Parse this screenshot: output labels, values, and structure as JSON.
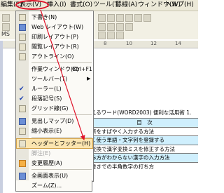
{
  "menubar": {
    "edit": "編集(E)",
    "view": "表示(V)",
    "insert": "挿入(I)",
    "format": "書式(O)",
    "tools": "ツール(T)",
    "table": "罫線(A)",
    "window": "ウィンドウ(W)",
    "help": "ヘルプ(H)"
  },
  "toolbar": {
    "font_label": "MS"
  },
  "ruler": {
    "digits": [
      "8",
      "10",
      "12",
      "14"
    ]
  },
  "view_menu": {
    "items": [
      {
        "label": "下書き(N)",
        "icon": "draft-icon"
      },
      {
        "label": "Web レイアウト(W)",
        "icon": "web-layout-icon"
      },
      {
        "label": "印刷レイアウト(P)",
        "icon": "print-layout-icon"
      },
      {
        "label": "閲覧レイアウト(R)",
        "icon": "reading-layout-icon"
      },
      {
        "label": "アウトライン(O)",
        "icon": "outline-icon"
      },
      {
        "label": "作業ウィンドウ(K)",
        "shortcut": "Ctrl+F1"
      },
      {
        "label": "ツールバー(T)",
        "submenu": true
      },
      {
        "label": "ルーラー(L)",
        "icon": "checkmark-icon"
      },
      {
        "label": "段落記号(S)",
        "icon": "checkmark-icon"
      },
      {
        "label": "グリッド線(G)",
        "icon": "grid-icon"
      },
      {
        "label": "見出しマップ(D)",
        "icon": "document-map-icon"
      },
      {
        "label": "縮小表示(E)",
        "icon": "thumbnails-icon"
      },
      {
        "label": "ヘッダーとフッター(H)",
        "icon": "header-footer-icon",
        "selected": true
      },
      {
        "label": "脚注(E)",
        "disabled": true
      },
      {
        "label": "変更履歴(A)",
        "icon": "markup-icon"
      },
      {
        "label": "全画面表示(U)",
        "icon": "full-screen-icon"
      },
      {
        "label": "ズーム(Z)..."
      }
    ]
  },
  "document": {
    "line1": "えるワード(WORD2003) 便利な活用術 1.",
    "table_header": "目　次",
    "rows": [
      "所をすばやく入力する方法",
      "く使う単語・文字列を登録する",
      "変換で漢字変換ミスを修正する方法",
      "み方がわからない漢字の入力方法",
      "書きでの半角数字の打ち方"
    ]
  },
  "colors": {
    "annotation": "#e0142a",
    "highlight": "#fbe5b0",
    "table_highlight": "#cfeffd"
  }
}
